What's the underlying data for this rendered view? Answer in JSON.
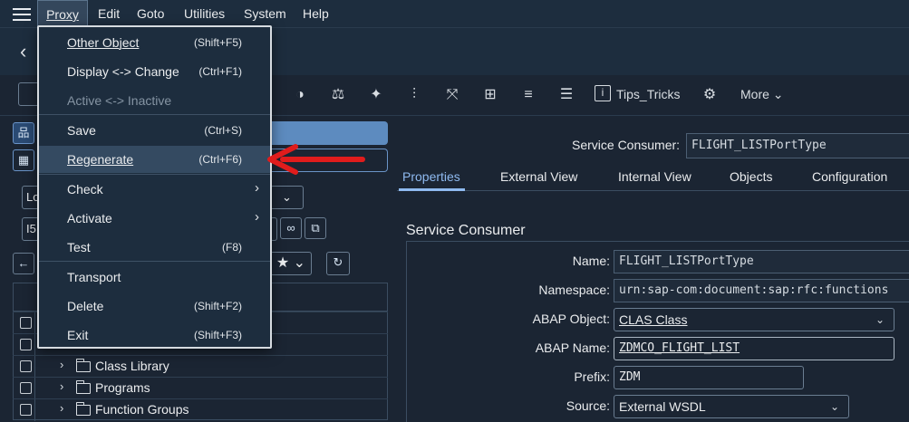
{
  "menubar": {
    "items": [
      "Proxy",
      "Edit",
      "Goto",
      "Utilities",
      "System",
      "Help"
    ]
  },
  "toolbar": {
    "tips_label": "Tips_Tricks",
    "more_label": "More"
  },
  "left": {
    "field1_value": "Lo",
    "field2_value": "I5"
  },
  "tree": {
    "rows": [
      "Class Library",
      "Programs",
      "Function Groups"
    ]
  },
  "right": {
    "service_consumer_label": "Service Consumer:",
    "service_consumer_value": "FLIGHT_LISTPortType",
    "tabs": [
      "Properties",
      "External View",
      "Internal View",
      "Objects",
      "Configuration"
    ],
    "section_title": "Service Consumer",
    "fields": {
      "name_label": "Name:",
      "name_value": "FLIGHT_LISTPortType",
      "namespace_label": "Namespace:",
      "namespace_value": "urn:sap-com:document:sap:rfc:functions",
      "abap_object_label": "ABAP Object:",
      "abap_object_value": "CLAS Class",
      "abap_name_label": "ABAP Name:",
      "abap_name_value": "ZDMCO_FLIGHT_LIST",
      "prefix_label": "Prefix:",
      "prefix_value": "ZDM",
      "source_label": "Source:",
      "source_value": "External WSDL"
    }
  },
  "dropdown": {
    "items": [
      {
        "label": "Other Object",
        "shortcut": "(Shift+F5)"
      },
      {
        "label": "Display <-> Change",
        "shortcut": "(Ctrl+F1)"
      },
      {
        "label": "Active <-> Inactive",
        "shortcut": ""
      },
      {
        "label": "Save",
        "shortcut": "(Ctrl+S)"
      },
      {
        "label": "Regenerate",
        "shortcut": "(Ctrl+F6)"
      },
      {
        "label": "Check",
        "shortcut": ""
      },
      {
        "label": "Activate",
        "shortcut": ""
      },
      {
        "label": "Test",
        "shortcut": "(F8)"
      },
      {
        "label": "Transport",
        "shortcut": ""
      },
      {
        "label": "Delete",
        "shortcut": "(Shift+F2)"
      },
      {
        "label": "Exit",
        "shortcut": "(Shift+F3)"
      }
    ]
  },
  "colors": {
    "accent": "#8fbaf0",
    "annotation_arrow": "#e01c1c"
  }
}
